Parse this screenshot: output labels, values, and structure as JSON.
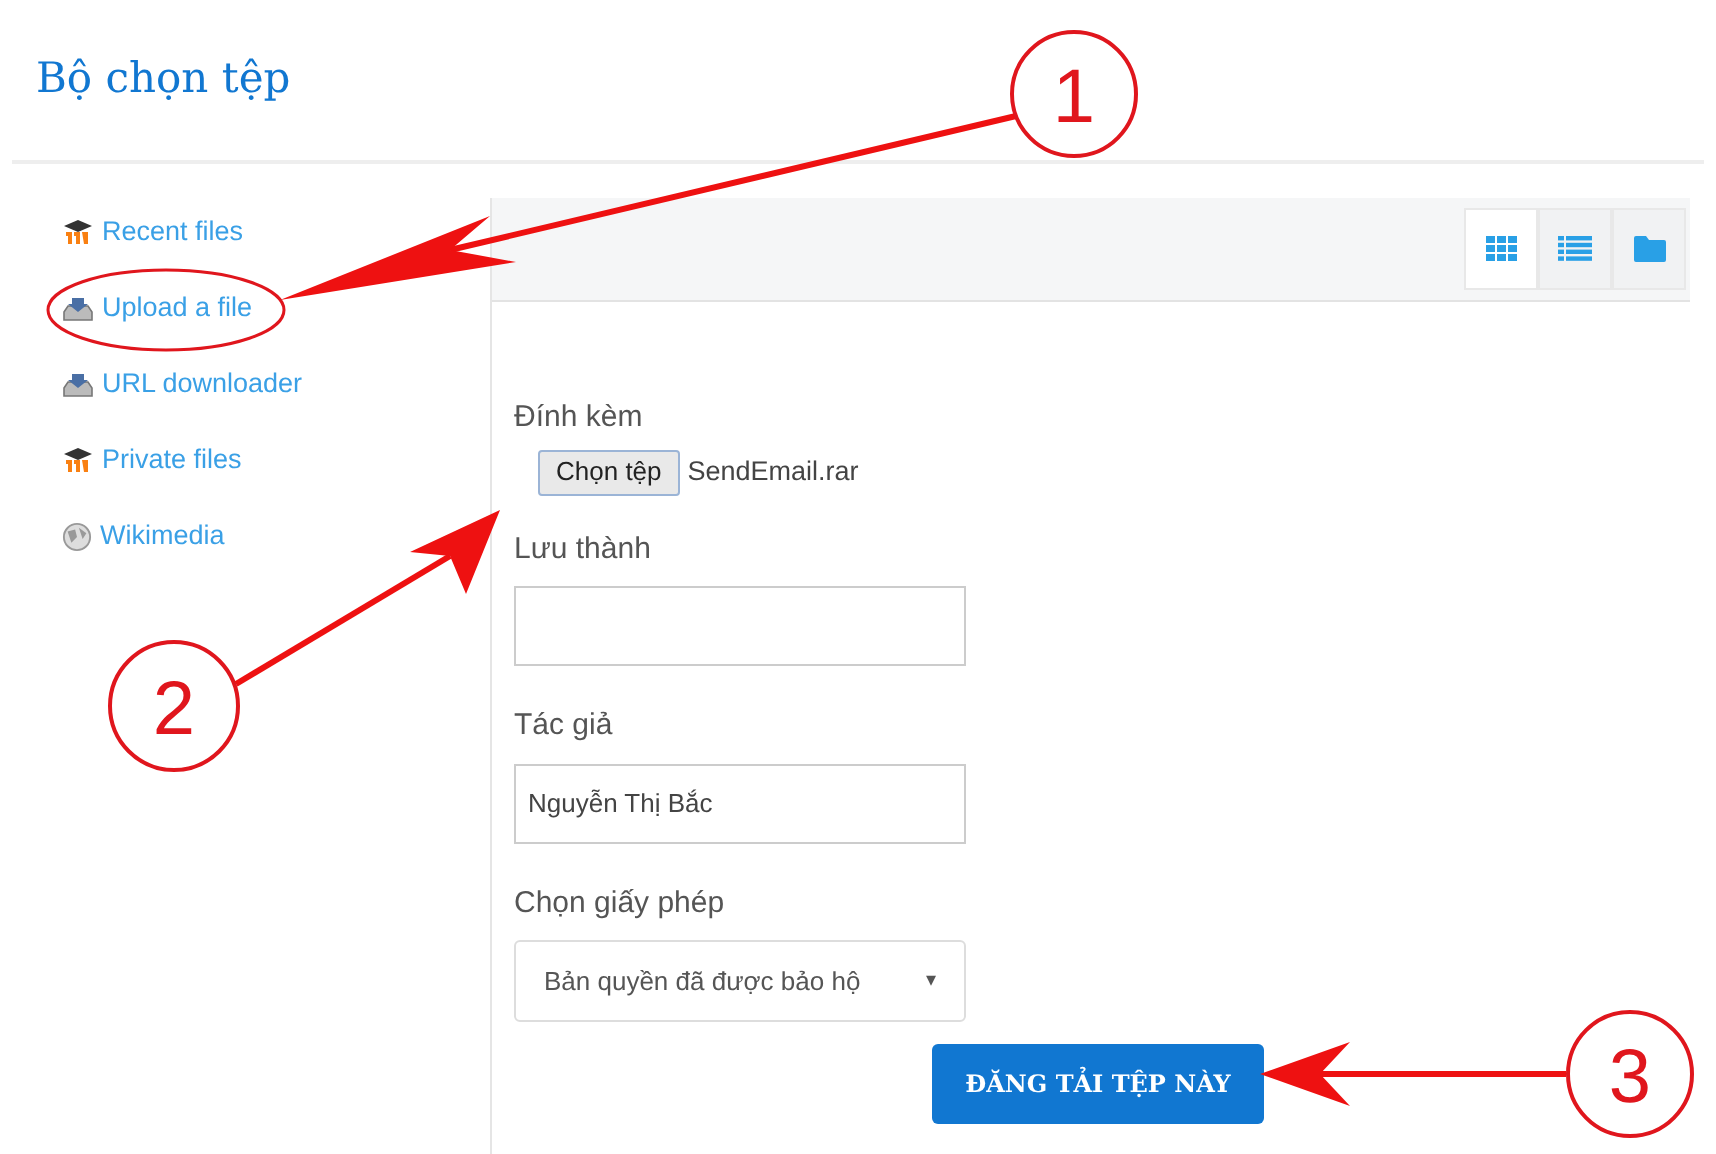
{
  "dialog": {
    "title": "Bộ chọn tệp"
  },
  "sidebar": {
    "items": [
      {
        "label": "Recent files",
        "kind": "repository"
      },
      {
        "label": "Upload a file",
        "kind": "upload"
      },
      {
        "label": "URL downloader",
        "kind": "upload"
      },
      {
        "label": "Private files",
        "kind": "repository"
      },
      {
        "label": "Wikimedia",
        "kind": "globe"
      }
    ]
  },
  "toolbar": {
    "views": [
      {
        "kind": "grid",
        "selected": true
      },
      {
        "kind": "list",
        "selected": false
      },
      {
        "kind": "folder",
        "selected": false
      }
    ]
  },
  "form": {
    "attachment": {
      "label": "Đính kèm",
      "button": "Chọn tệp",
      "file_name": "SendEmail.rar"
    },
    "save_as": {
      "label": "Lưu thành"
    },
    "author": {
      "label": "Tác giả",
      "value": "Nguyễn Thị Bắc"
    },
    "license": {
      "label": "Chọn giấy phép",
      "value": "Bản quyền đã được bảo hộ",
      "arrow": "▾"
    },
    "submit": "ĐĂNG TẢI TỆP NÀY"
  },
  "annotations": {
    "callouts": [
      "1",
      "2",
      "3"
    ]
  }
}
